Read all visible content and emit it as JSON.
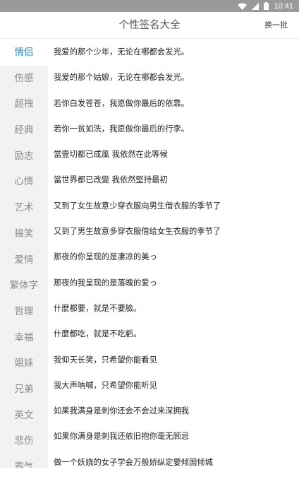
{
  "status": {
    "time": "10:41",
    "icons": [
      "wifi-icon",
      "signal-icon",
      "battery-icon"
    ]
  },
  "header": {
    "title": "个性签名大全",
    "refresh_label": "换一批"
  },
  "sidebar": {
    "items": [
      {
        "label": "情侣",
        "active": true
      },
      {
        "label": "伤感"
      },
      {
        "label": "超拽"
      },
      {
        "label": "经典"
      },
      {
        "label": "励志"
      },
      {
        "label": "心情"
      },
      {
        "label": "艺术"
      },
      {
        "label": "搞笑"
      },
      {
        "label": "爱情"
      },
      {
        "label": "繁体字"
      },
      {
        "label": "哲理"
      },
      {
        "label": "幸福"
      },
      {
        "label": "姐妹"
      },
      {
        "label": "兄弟"
      },
      {
        "label": "英文"
      },
      {
        "label": "悲伤"
      },
      {
        "label": "霸气"
      }
    ]
  },
  "signatures": [
    "我爱的那个少年，无论在哪都会发光。",
    "我爱的那个姑娘，无论在哪都会发光。",
    "若你白发苍苍，我愿做你最后的依靠。",
    "若你一贫如洗，我愿做你最后的行李。",
    "當壹切都已成風 我依然在此等候",
    "當世界都已改變 我依然堅持最初",
    "又到了女生故意少穿衣服向男生借衣服的季节了",
    "又到了男生故意多穿衣服借给女生衣服的季节了",
    "那夜的你呈现的是凄凉的美っ",
    "那夜的我呈现的是落魄的爱っ",
    "什麼都要，就是不要臉。",
    "什麼都吃，就是不吃虧。",
    "我仰天长笑，只希望你能看见",
    "我大声呐喊，只希望你能听见",
    "如果我满身是刺你还会不会过来深拥我",
    "如果你满身是刺我还依旧抱你毫无顾忌",
    "做一个妖娆的女子学会万般娇纵定要倾国倾城"
  ],
  "colors": {
    "accent": "#2a8fd8",
    "sidebar_bg": "#f2f2f2",
    "status_bar": "#9a9a9a"
  }
}
